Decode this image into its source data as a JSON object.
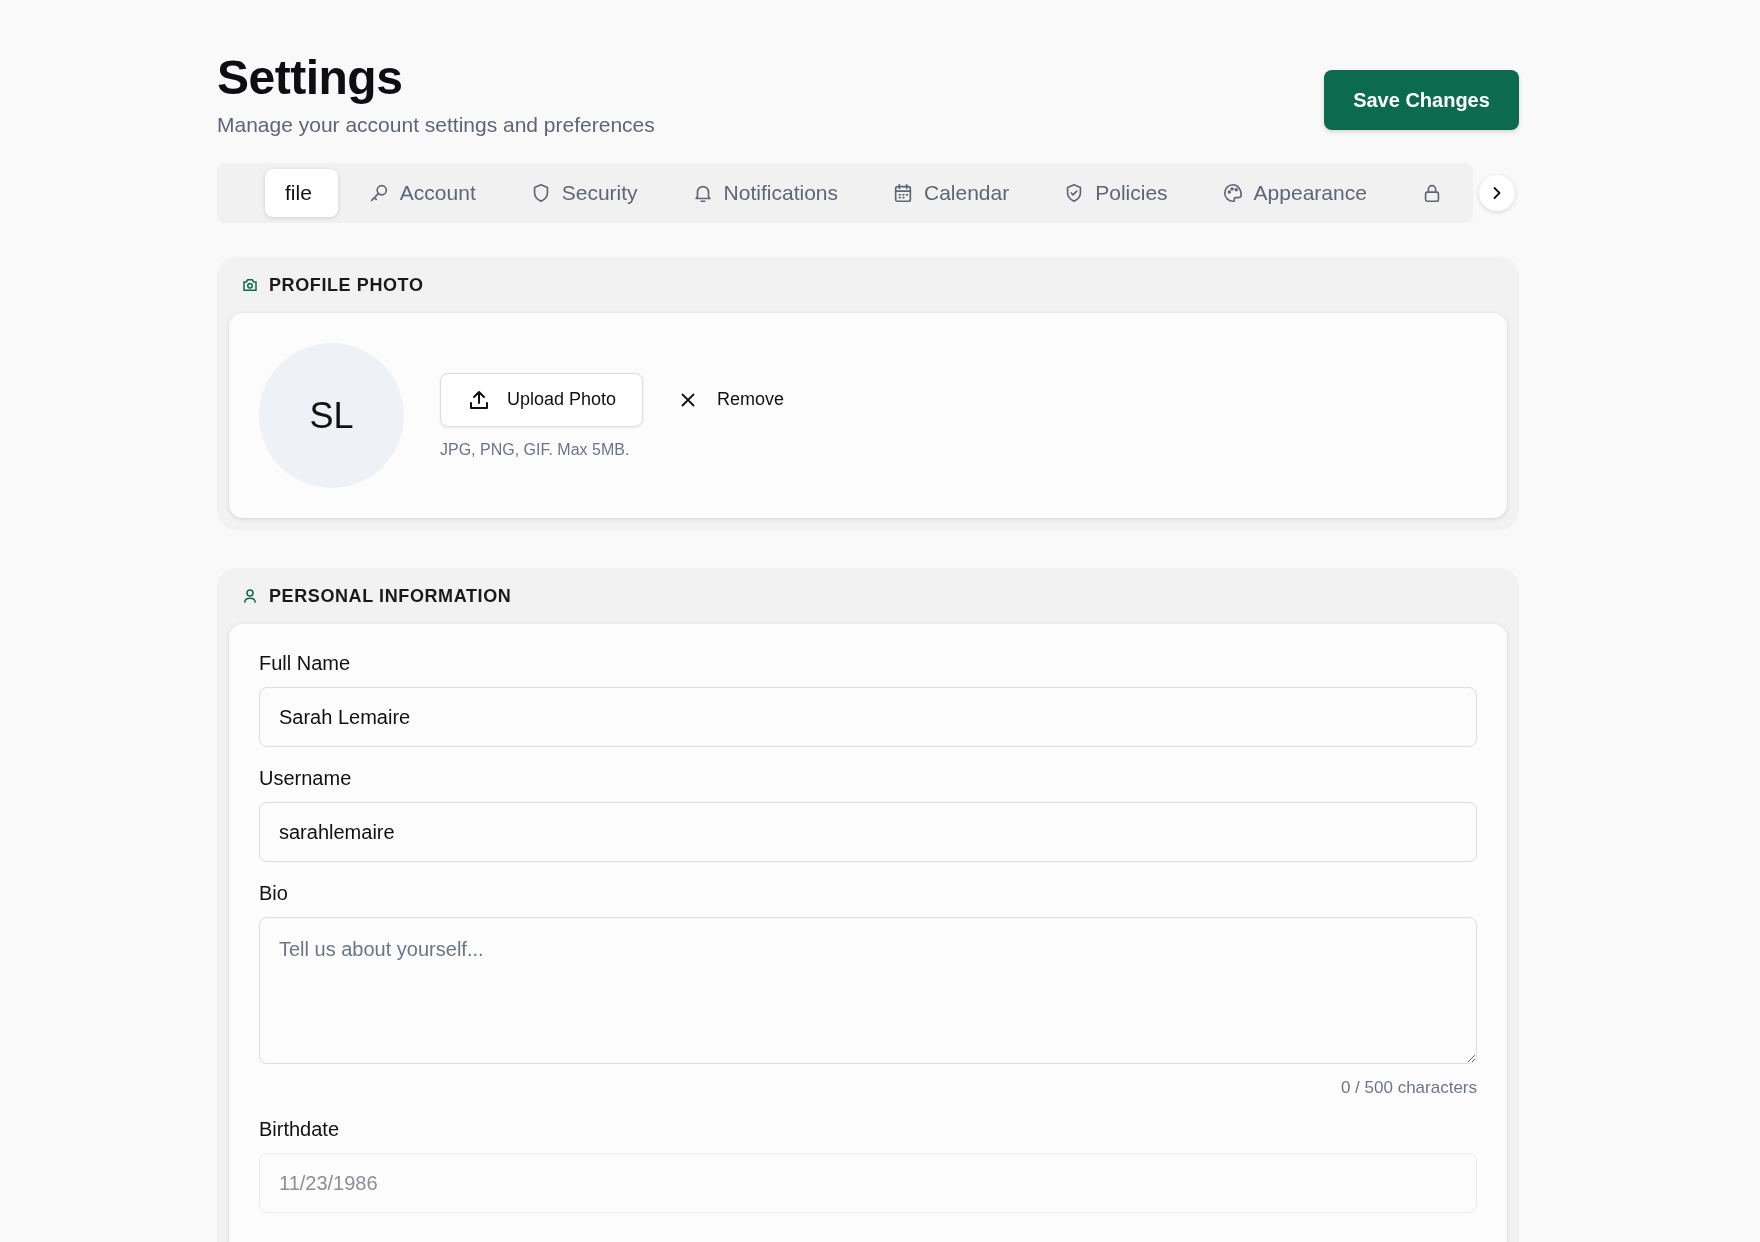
{
  "header": {
    "title": "Settings",
    "subtitle": "Manage your account settings and preferences",
    "save_button": "Save Changes"
  },
  "tabs": [
    {
      "label": "file",
      "selected": true
    },
    {
      "label": "Account",
      "selected": false
    },
    {
      "label": "Security",
      "selected": false
    },
    {
      "label": "Notifications",
      "selected": false
    },
    {
      "label": "Calendar",
      "selected": false
    },
    {
      "label": "Policies",
      "selected": false
    },
    {
      "label": "Appearance",
      "selected": false
    },
    {
      "selected": false
    }
  ],
  "profile_photo": {
    "heading": "PROFILE PHOTO",
    "initials": "SL",
    "upload_button": "Upload Photo",
    "remove_button": "Remove",
    "hint": "JPG, PNG, GIF. Max 5MB."
  },
  "personal_information": {
    "heading": "PERSONAL INFORMATION",
    "fields": [
      {
        "kind": "text",
        "label": "Full Name",
        "value": "Sarah Lemaire",
        "disabled": false
      },
      {
        "kind": "text",
        "label": "Username",
        "value": "sarahlemaire",
        "disabled": false
      },
      {
        "kind": "textarea",
        "label": "Bio",
        "placeholder": "Tell us about yourself...",
        "counter": "0 / 500 characters",
        "disabled": false
      },
      {
        "kind": "text",
        "label": "Birthdate",
        "value": "11/23/1986",
        "disabled": true
      }
    ]
  }
}
